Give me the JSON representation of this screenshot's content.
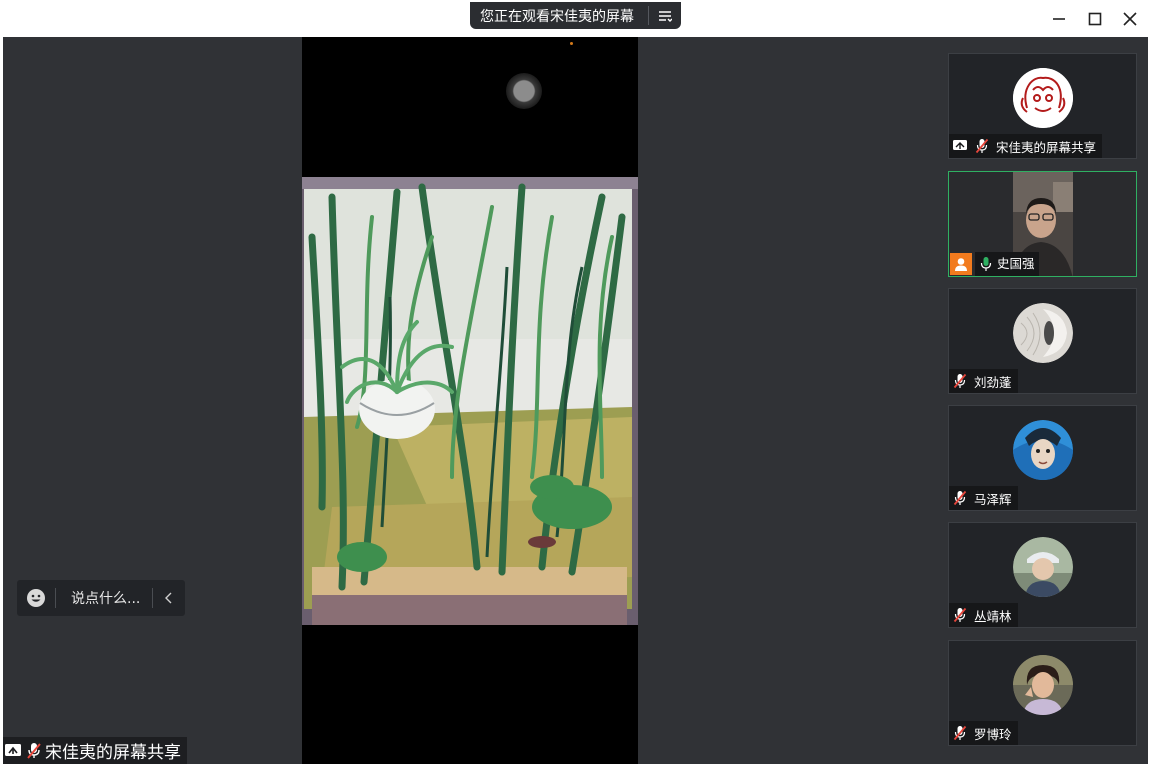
{
  "titlebar": {
    "share_notice": "您正在观看宋佳夷的屏幕",
    "menu_icon": "list-menu-icon",
    "minimize_icon": "minimize-icon",
    "maximize_icon": "maximize-icon",
    "close_icon": "close-icon"
  },
  "stage": {
    "chat_placeholder": "说点什么...",
    "emoji_icon": "smiley-icon",
    "collapse_icon": "chevron-left-icon",
    "main_label": "宋佳夷的屏幕共享"
  },
  "participants": [
    {
      "name": "宋佳夷的屏幕共享",
      "mic": "muted",
      "sharing": true
    },
    {
      "name": "史国强",
      "mic": "on",
      "video": true,
      "active": true
    },
    {
      "name": "刘劲蓬",
      "mic": "muted"
    },
    {
      "name": "马泽辉",
      "mic": "muted"
    },
    {
      "name": "丛靖林",
      "mic": "muted"
    },
    {
      "name": "罗博玲",
      "mic": "muted"
    }
  ],
  "colors": {
    "stage_bg": "#303236",
    "tile_bg": "#222428",
    "active_border": "#2fb062",
    "mic_on": "#2fb062",
    "mic_muted": "#e8463c",
    "camera_off_badge": "#f27b1e"
  }
}
